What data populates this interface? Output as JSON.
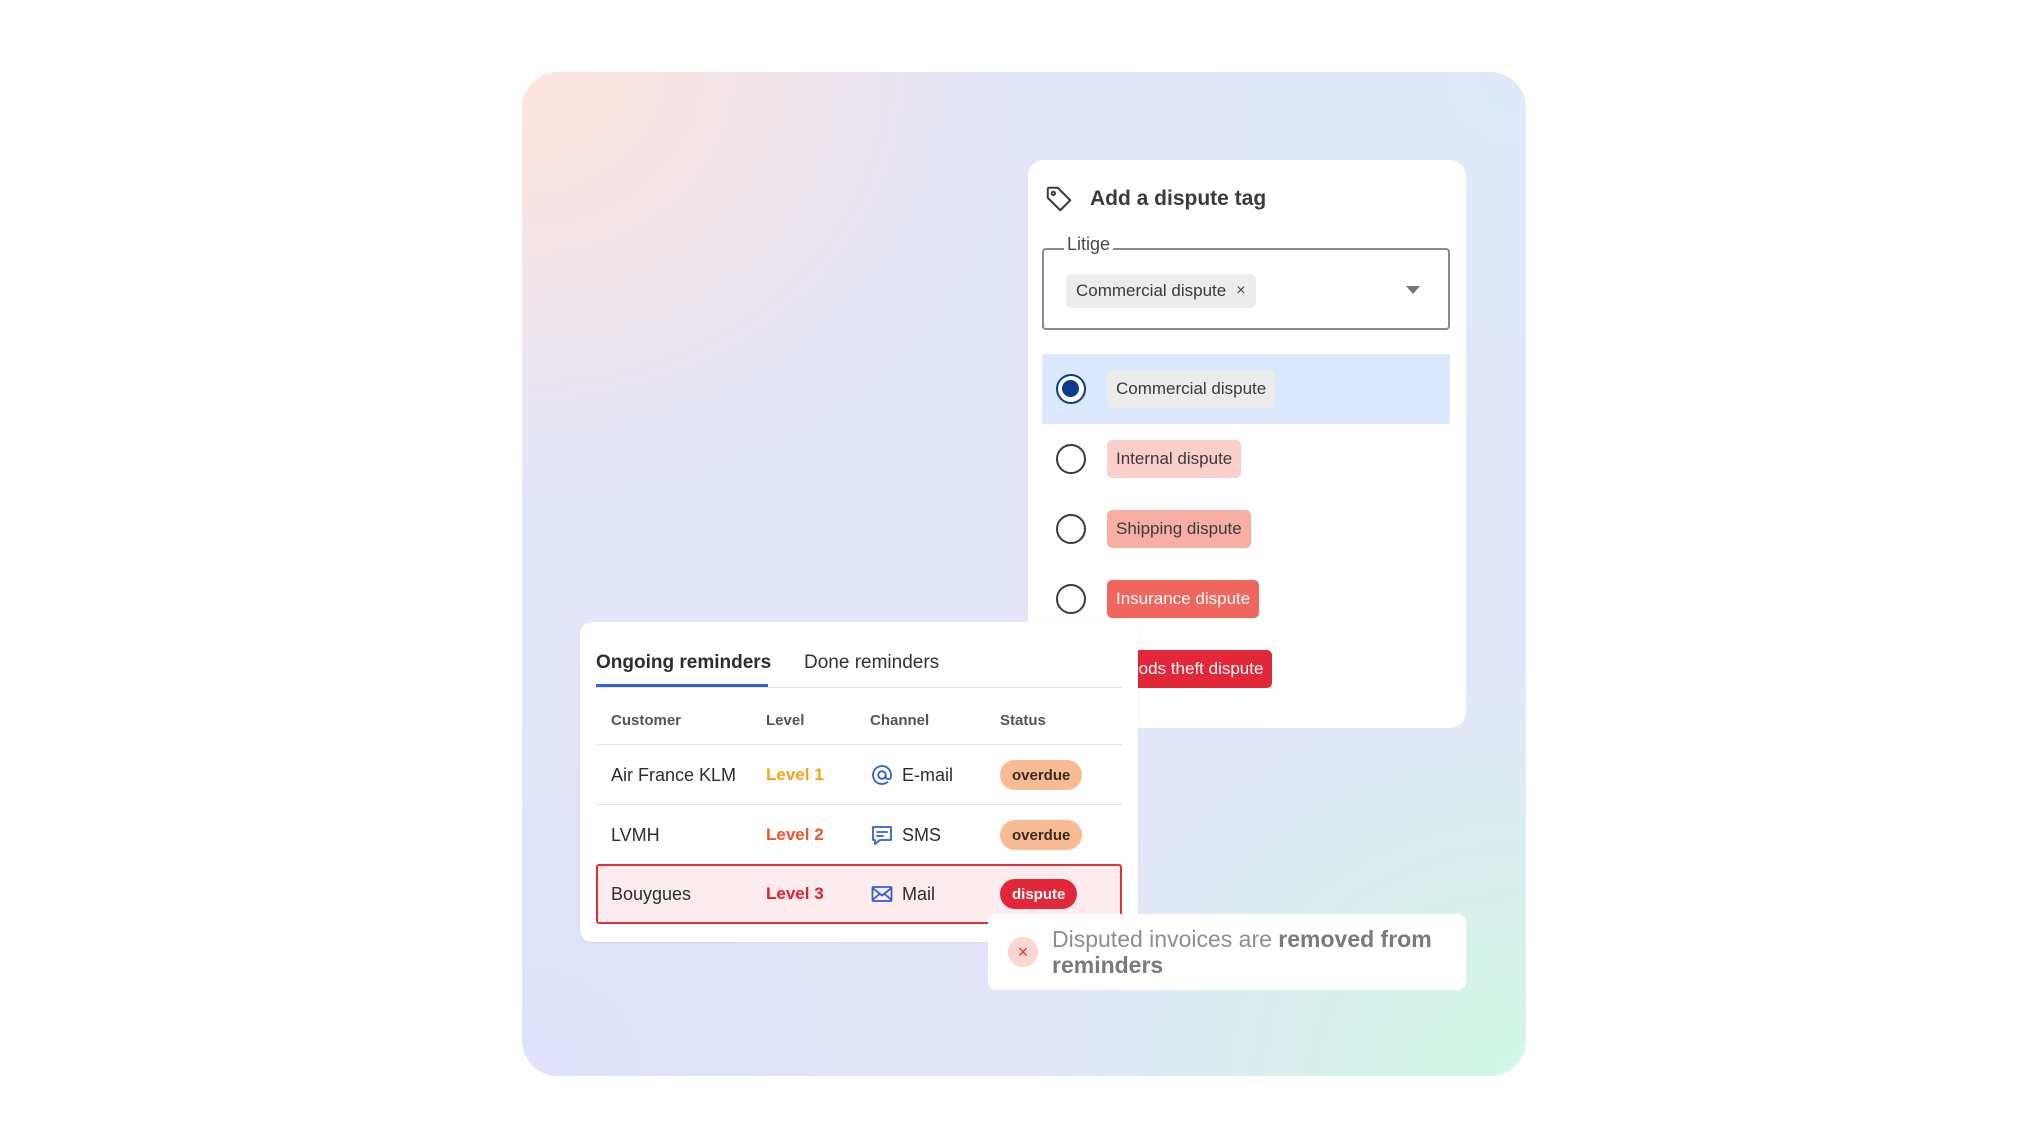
{
  "dispute_card": {
    "title": "Add a dispute tag",
    "field_label": "Litige",
    "selected_chip": "Commercial dispute",
    "chip_remove": "×",
    "options": [
      {
        "label": "Commercial dispute",
        "selected": true,
        "bg": "#ececec",
        "fg": "#3a3a3a"
      },
      {
        "label": "Internal dispute",
        "selected": false,
        "bg": "#fbcfca",
        "fg": "#3a3a3a"
      },
      {
        "label": "Shipping dispute",
        "selected": false,
        "bg": "#f8aea5",
        "fg": "#3a3a3a"
      },
      {
        "label": "Insurance dispute",
        "selected": false,
        "bg": "#f0655c",
        "fg": "#ffffff"
      },
      {
        "label": "Goods theft dispute",
        "selected": false,
        "bg": "#e22838",
        "fg": "#ffffff"
      }
    ]
  },
  "reminders": {
    "tabs": [
      {
        "label": "Ongoing reminders",
        "active": true
      },
      {
        "label": "Done reminders",
        "active": false
      }
    ],
    "columns": [
      "Customer",
      "Level",
      "Channel",
      "Status"
    ],
    "rows": [
      {
        "customer": "Air France KLM",
        "level": "Level 1",
        "level_color": "#f2a613",
        "channel": "E-mail",
        "channel_icon": "at-icon",
        "status": "overdue",
        "status_bg": "#f9bb93",
        "status_fg": "#3a2a20"
      },
      {
        "customer": "LVMH",
        "level": "Level 2",
        "level_color": "#f0522c",
        "channel": "SMS",
        "channel_icon": "chat-icon",
        "status": "overdue",
        "status_bg": "#f9bb93",
        "status_fg": "#3a2a20"
      },
      {
        "customer": "Bouygues",
        "level": "Level 3",
        "level_color": "#e0202f",
        "channel": "Mail",
        "channel_icon": "mail-icon",
        "status": "dispute",
        "status_bg": "#e22838",
        "status_fg": "#ffffff",
        "highlighted": true
      }
    ]
  },
  "toast": {
    "icon": "×",
    "text_plain": "Disputed invoices are ",
    "text_bold": "removed from reminders"
  },
  "colors": {
    "accent": "#2f5fd0",
    "radio_selected": "#0e3a8e",
    "alert": "#e0303d"
  }
}
